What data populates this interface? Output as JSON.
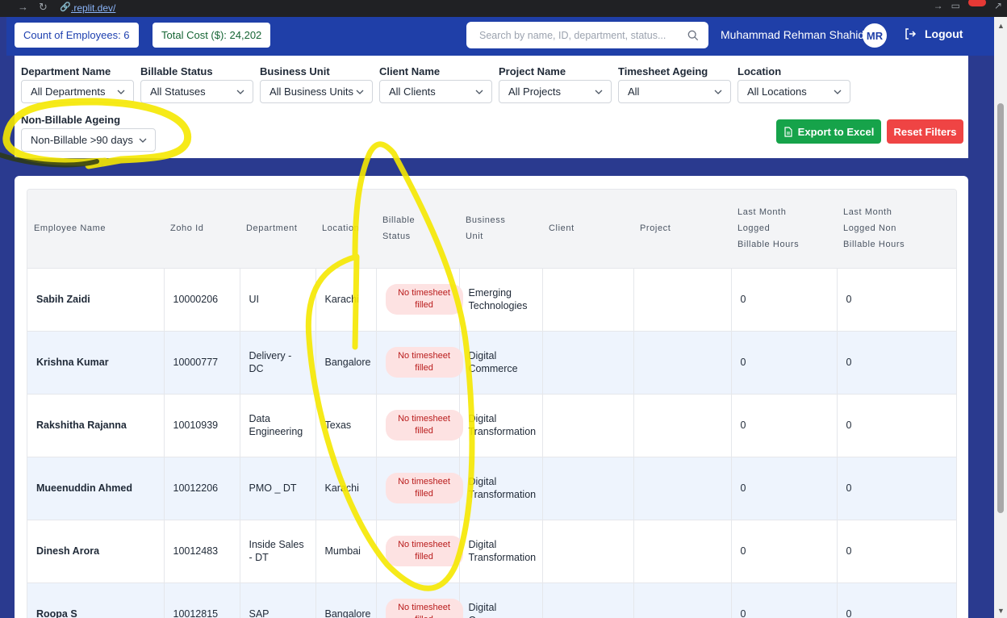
{
  "browser": {
    "url": ".replit.dev/"
  },
  "header": {
    "employee_count": "Count of Employees: 6",
    "total_cost": "Total Cost ($): 24,202",
    "search_placeholder": "Search by name, ID, department, status...",
    "user_name": "Muhammad Rehman Shahid",
    "user_initials": "MR",
    "logout_label": "Logout"
  },
  "filters": {
    "department": {
      "label": "Department Name",
      "value": "All Departments"
    },
    "billable_status": {
      "label": "Billable Status",
      "value": "All Statuses"
    },
    "business_unit": {
      "label": "Business Unit",
      "value": "All Business Units"
    },
    "client": {
      "label": "Client Name",
      "value": "All Clients"
    },
    "project": {
      "label": "Project Name",
      "value": "All Projects"
    },
    "timesheet_ageing": {
      "label": "Timesheet Ageing",
      "value": "All"
    },
    "location": {
      "label": "Location",
      "value": "All Locations"
    },
    "non_billable_ageing": {
      "label": "Non-Billable Ageing",
      "value": "Non-Billable >90 days"
    },
    "export_label": "Export to Excel",
    "reset_label": "Reset Filters"
  },
  "table": {
    "columns": [
      [
        "Employee Name"
      ],
      [
        "Zoho Id"
      ],
      [
        "Department"
      ],
      [
        "Location"
      ],
      [
        "Billable",
        "Status"
      ],
      [
        "Business",
        "Unit"
      ],
      [
        "Client"
      ],
      [
        "Project"
      ],
      [
        "Last Month",
        "Logged",
        "Billable Hours"
      ],
      [
        "Last Month",
        "Logged Non",
        "Billable Hours"
      ]
    ],
    "rows": [
      {
        "name": "Sabih Zaidi",
        "zoho_id": "10000206",
        "department": "UI",
        "location": "Karachi",
        "status": "No timesheet filled",
        "business_unit": "Emerging Technologies",
        "client": "",
        "project": "",
        "billable_hours": "0",
        "non_billable_hours": "0"
      },
      {
        "name": "Krishna Kumar",
        "zoho_id": "10000777",
        "department": "Delivery - DC",
        "location": "Bangalore",
        "status": "No timesheet filled",
        "business_unit": "Digital Commerce",
        "client": "",
        "project": "",
        "billable_hours": "0",
        "non_billable_hours": "0"
      },
      {
        "name": "Rakshitha Rajanna",
        "zoho_id": "10010939",
        "department": "Data Engineering",
        "location": "Texas",
        "status": "No timesheet filled",
        "business_unit": "Digital Transformation",
        "client": "",
        "project": "",
        "billable_hours": "0",
        "non_billable_hours": "0"
      },
      {
        "name": "Mueenuddin Ahmed",
        "zoho_id": "10012206",
        "department": "PMO _ DT",
        "location": "Karachi",
        "status": "No timesheet filled",
        "business_unit": "Digital Transformation",
        "client": "",
        "project": "",
        "billable_hours": "0",
        "non_billable_hours": "0"
      },
      {
        "name": "Dinesh Arora",
        "zoho_id": "10012483",
        "department": "Inside Sales - DT",
        "location": "Mumbai",
        "status": "No timesheet filled",
        "business_unit": "Digital Transformation",
        "client": "",
        "project": "",
        "billable_hours": "0",
        "non_billable_hours": "0"
      },
      {
        "name": "Roopa S",
        "zoho_id": "10012815",
        "department": "SAP",
        "location": "Bangalore",
        "status": "No timesheet filled",
        "business_unit": "Digital Commerce",
        "client": "",
        "project": "",
        "billable_hours": "0",
        "non_billable_hours": "0"
      }
    ]
  },
  "colors": {
    "header_bg": "#1f3fa8",
    "export_green": "#16a34a",
    "reset_red": "#ef4444",
    "status_pill_bg": "#fde2e2",
    "annotation_yellow": "#f5e800"
  }
}
